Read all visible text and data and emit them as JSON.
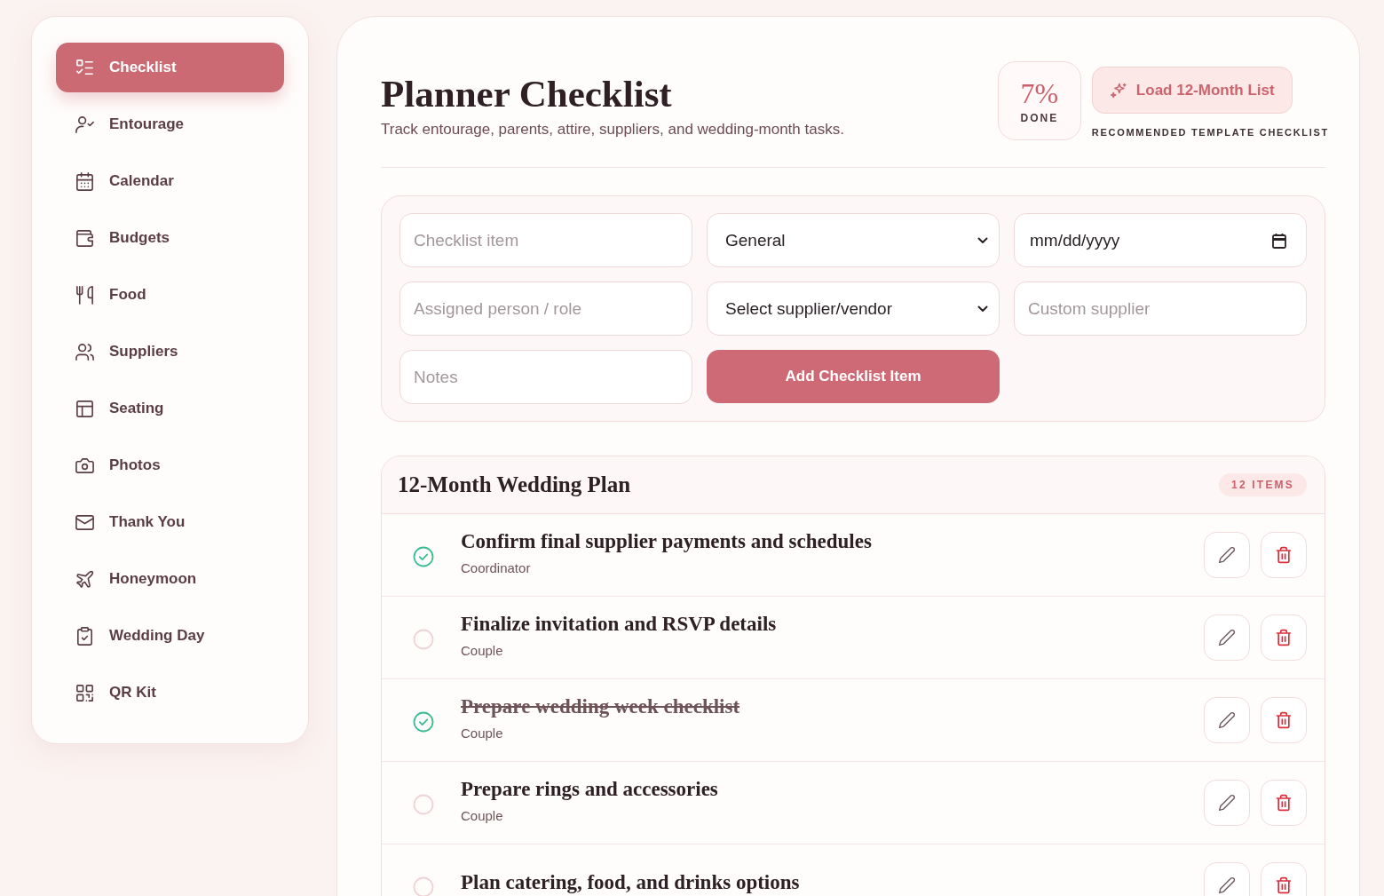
{
  "sidebar": {
    "items": [
      {
        "label": "Checklist",
        "selected": true
      },
      {
        "label": "Entourage",
        "selected": false
      },
      {
        "label": "Calendar",
        "selected": false
      },
      {
        "label": "Budgets",
        "selected": false
      },
      {
        "label": "Food",
        "selected": false
      },
      {
        "label": "Suppliers",
        "selected": false
      },
      {
        "label": "Seating",
        "selected": false
      },
      {
        "label": "Photos",
        "selected": false
      },
      {
        "label": "Thank You",
        "selected": false
      },
      {
        "label": "Honeymoon",
        "selected": false
      },
      {
        "label": "Wedding Day",
        "selected": false
      },
      {
        "label": "QR Kit",
        "selected": false
      }
    ]
  },
  "header": {
    "title": "Planner Checklist",
    "subtitle": "Track entourage, parents, attire, suppliers, and wedding-month tasks.",
    "progress": {
      "value": "7%",
      "label": "DONE"
    },
    "load_button": {
      "label": "Load 12-Month List"
    },
    "caption": "RECOMMENDED TEMPLATE CHECKLIST"
  },
  "form": {
    "fields": [
      {
        "kind": "text",
        "placeholder": "Checklist item"
      },
      {
        "kind": "select",
        "value": "General"
      },
      {
        "kind": "date",
        "value": "mm/dd/yyyy"
      },
      {
        "kind": "text",
        "placeholder": "Assigned person / role"
      },
      {
        "kind": "select",
        "value": "Select supplier/vendor"
      },
      {
        "kind": "text",
        "placeholder": "Custom supplier"
      },
      {
        "kind": "text",
        "placeholder": "Notes"
      },
      {
        "kind": "button",
        "label": "Add Checklist Item"
      }
    ]
  },
  "plan": {
    "title": "12-Month Wedding Plan",
    "count": "12 ITEMS",
    "items": [
      {
        "title": "Confirm final supplier payments and schedules",
        "assignee": "Coordinator",
        "checked": true,
        "struck": false
      },
      {
        "title": "Finalize invitation and RSVP details",
        "assignee": "Couple",
        "checked": false,
        "struck": false
      },
      {
        "title": "Prepare wedding week checklist",
        "assignee": "Couple",
        "checked": true,
        "struck": true
      },
      {
        "title": "Prepare rings and accessories",
        "assignee": "Couple",
        "checked": false,
        "struck": false
      },
      {
        "title": "Plan catering, food, and drinks options",
        "checked": false,
        "struck": false
      }
    ]
  }
}
